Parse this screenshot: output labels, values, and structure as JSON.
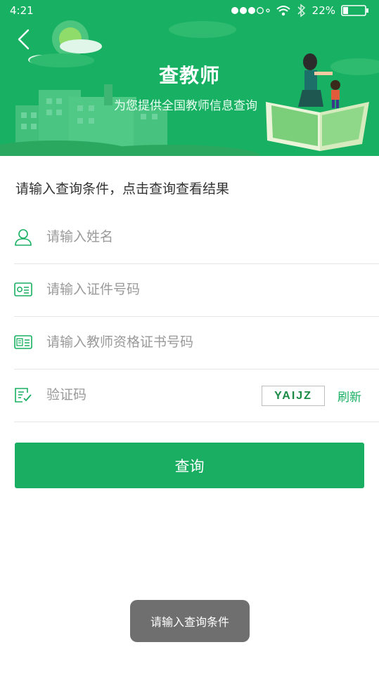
{
  "status_bar": {
    "time": "4:21",
    "battery": "22%"
  },
  "header": {
    "title": "查教师",
    "subtitle": "为您提供全国教师信息查询"
  },
  "form": {
    "instruction": "请输入查询条件，点击查询查看结果",
    "name_placeholder": "请输入姓名",
    "id_placeholder": "请输入证件号码",
    "cert_placeholder": "请输入教师资格证书号码",
    "captcha_placeholder": "验证码",
    "captcha_text": "YAIJZ",
    "refresh_label": "刷新",
    "submit_label": "查询"
  },
  "toast": {
    "message": "请输入查询条件"
  },
  "colors": {
    "primary": "#18b062",
    "button": "#1aae62",
    "toast_bg": "#6f6f6f"
  },
  "icons": [
    "back-icon",
    "signal-icon",
    "wifi-icon",
    "bluetooth-icon",
    "battery-icon",
    "user-icon",
    "id-card-icon",
    "certificate-icon",
    "verify-icon"
  ]
}
